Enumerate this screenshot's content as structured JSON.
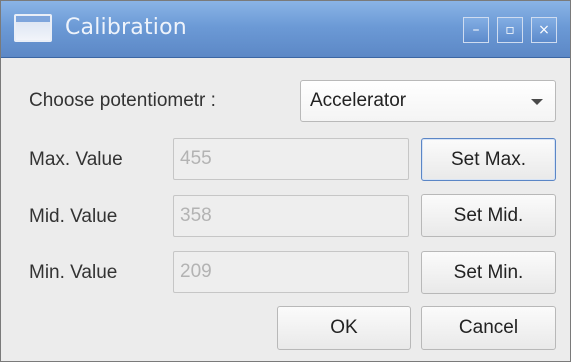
{
  "window": {
    "title": "Calibration",
    "controls": {
      "minimize_icon": "minimize-icon",
      "maximize_icon": "maximize-icon",
      "close_icon": "close-icon",
      "minimize_glyph": "–",
      "maximize_glyph": "▫",
      "close_glyph": "×"
    },
    "titlebar_color": "#6c9ad6"
  },
  "form": {
    "potentiometer": {
      "label": "Choose potentiometr :",
      "selected": "Accelerator"
    },
    "max": {
      "label": "Max. Value",
      "value": "455",
      "button": "Set Max."
    },
    "mid": {
      "label": "Mid. Value",
      "value": "358",
      "button": "Set Mid."
    },
    "min": {
      "label": "Min. Value",
      "value": "209",
      "button": "Set Min."
    }
  },
  "actions": {
    "ok": "OK",
    "cancel": "Cancel"
  }
}
